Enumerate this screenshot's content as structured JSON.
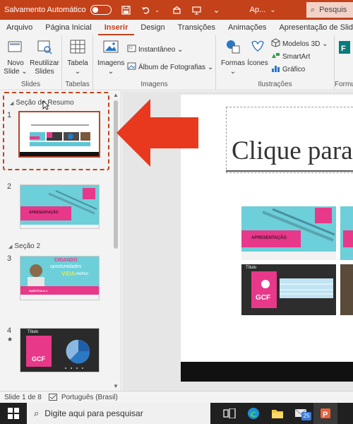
{
  "titlebar": {
    "autosave_label": "Salvamento Automático",
    "filename": "Ap...",
    "search_placeholder": "Pesquis"
  },
  "tabs": [
    "Arquivo",
    "Página Inicial",
    "Inserir",
    "Design",
    "Transições",
    "Animações",
    "Apresentação de Slide"
  ],
  "active_tab": "Inserir",
  "ribbon": {
    "slides": {
      "label": "Slides",
      "novo_slide": "Novo\nSlide",
      "novo_slide_l1": "Novo",
      "novo_slide_l2": "Slide ⌄",
      "reutilizar_l1": "Reutilizar",
      "reutilizar_l2": "Slides"
    },
    "tabelas": {
      "label": "Tabelas",
      "tabela_l1": "Tabela",
      "tabela_l2": "⌄"
    },
    "imagens": {
      "label": "Imagens",
      "imagens_btn": "Imagens",
      "imagens_l2": "⌄",
      "instantaneo": "Instantâneo ⌄",
      "album": "Álbum de Fotografias ⌄"
    },
    "ilustracoes": {
      "label": "Ilustrações",
      "formas_l1": "Formas",
      "formas_l2": "⌄",
      "icones": "Ícones",
      "modelos3d": "Modelos 3D ⌄",
      "smartart": "SmartArt",
      "grafico": "Gráfico"
    },
    "forms": {
      "label": "Formu"
    }
  },
  "pane": {
    "section1": "Seção de Resumo",
    "section2": "Seção 2",
    "slides": [
      {
        "num": "1"
      },
      {
        "num": "2",
        "label": "APRESENTAÇÃO"
      },
      {
        "num": "3",
        "line1": "CRIANDO",
        "line2": "oportunidades",
        "line3": "VIDA",
        "line4": "melhor",
        "sub": "SUBTÍTULO 1"
      },
      {
        "num": "4",
        "star": "★",
        "title": "Título",
        "brand": "GCF"
      }
    ]
  },
  "main": {
    "title_text": "Clique para",
    "card1_label": "APRESENTAÇÃO",
    "card2_title": "Título",
    "card2_brand": "GCF"
  },
  "status": {
    "slide_info": "Slide 1 de 8",
    "language": "Português (Brasil)"
  },
  "taskbar": {
    "search_placeholder": "Digite aqui para pesquisar",
    "mail_badge": "25"
  },
  "colors": {
    "accent": "#c4421a",
    "pink": "#e8388a",
    "teal": "#5fc6d5",
    "arrow_red": "#e8391f"
  }
}
